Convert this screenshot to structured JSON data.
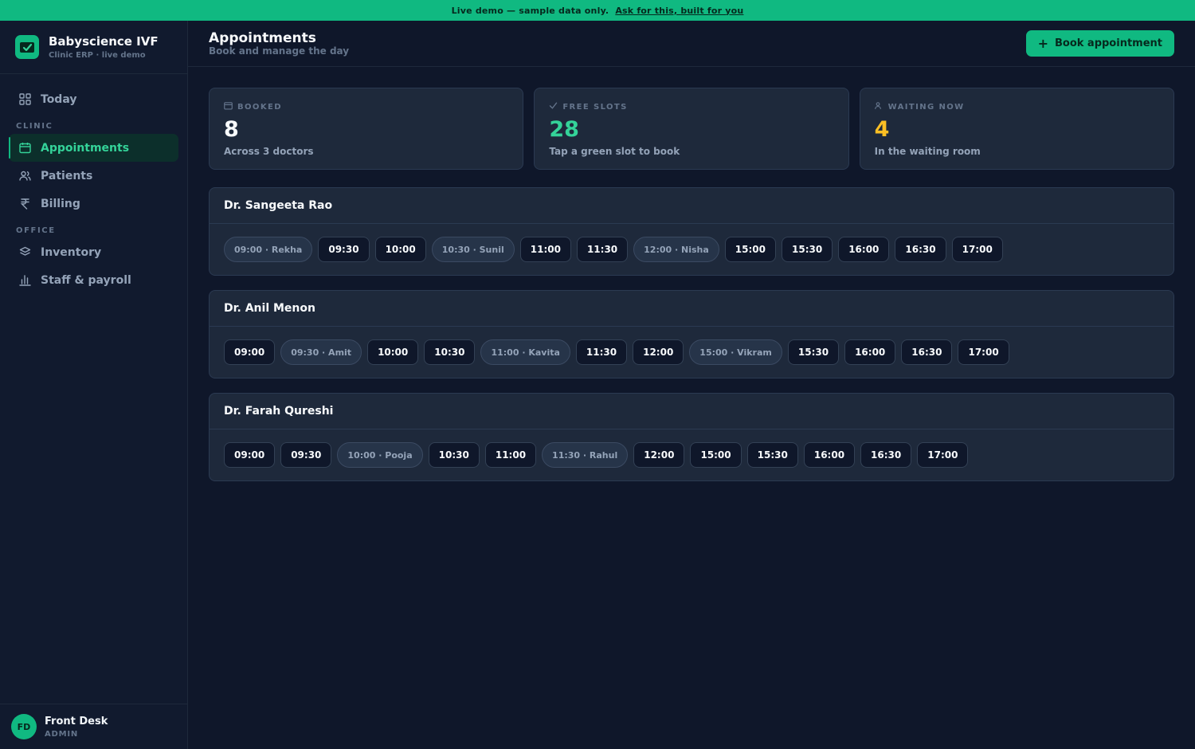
{
  "banner": {
    "text": "Live demo — sample data only.",
    "link": "Ask for this, built for you"
  },
  "brand": {
    "name": "Babyscience IVF",
    "subtitle": "Clinic ERP · live demo"
  },
  "nav": {
    "today": "Today",
    "section_clinic": "CLINIC",
    "appointments": "Appointments",
    "patients": "Patients",
    "billing": "Billing",
    "section_office": "OFFICE",
    "inventory": "Inventory",
    "staff": "Staff & payroll"
  },
  "user": {
    "initials": "FD",
    "name": "Front Desk",
    "role": "ADMIN"
  },
  "header": {
    "title": "Appointments",
    "subtitle": "Book and manage the day",
    "book_button": "Book appointment"
  },
  "stats": [
    {
      "label": "BOOKED",
      "value": "8",
      "note": "Across 3 doctors",
      "color": "#f8fafc"
    },
    {
      "label": "FREE SLOTS",
      "value": "28",
      "note": "Tap a green slot to book",
      "color": "#34d399"
    },
    {
      "label": "WAITING NOW",
      "value": "4",
      "note": "In the waiting room",
      "color": "#fbbf24"
    }
  ],
  "doctors": [
    {
      "name": "Dr. Sangeeta Rao",
      "slots": [
        {
          "label": "09:00 · Rekha",
          "booked": true
        },
        {
          "label": "09:30",
          "booked": false
        },
        {
          "label": "10:00",
          "booked": false
        },
        {
          "label": "10:30 · Sunil",
          "booked": true
        },
        {
          "label": "11:00",
          "booked": false
        },
        {
          "label": "11:30",
          "booked": false
        },
        {
          "label": "12:00 · Nisha",
          "booked": true
        },
        {
          "label": "15:00",
          "booked": false
        },
        {
          "label": "15:30",
          "booked": false
        },
        {
          "label": "16:00",
          "booked": false
        },
        {
          "label": "16:30",
          "booked": false
        },
        {
          "label": "17:00",
          "booked": false
        }
      ]
    },
    {
      "name": "Dr. Anil Menon",
      "slots": [
        {
          "label": "09:00",
          "booked": false
        },
        {
          "label": "09:30 · Amit",
          "booked": true
        },
        {
          "label": "10:00",
          "booked": false
        },
        {
          "label": "10:30",
          "booked": false
        },
        {
          "label": "11:00 · Kavita",
          "booked": true
        },
        {
          "label": "11:30",
          "booked": false
        },
        {
          "label": "12:00",
          "booked": false
        },
        {
          "label": "15:00 · Vikram",
          "booked": true
        },
        {
          "label": "15:30",
          "booked": false
        },
        {
          "label": "16:00",
          "booked": false
        },
        {
          "label": "16:30",
          "booked": false
        },
        {
          "label": "17:00",
          "booked": false
        }
      ]
    },
    {
      "name": "Dr. Farah Qureshi",
      "slots": [
        {
          "label": "09:00",
          "booked": false
        },
        {
          "label": "09:30",
          "booked": false
        },
        {
          "label": "10:00 · Pooja",
          "booked": true
        },
        {
          "label": "10:30",
          "booked": false
        },
        {
          "label": "11:00",
          "booked": false
        },
        {
          "label": "11:30 · Rahul",
          "booked": true
        },
        {
          "label": "12:00",
          "booked": false
        },
        {
          "label": "15:00",
          "booked": false
        },
        {
          "label": "15:30",
          "booked": false
        },
        {
          "label": "16:00",
          "booked": false
        },
        {
          "label": "16:30",
          "booked": false
        },
        {
          "label": "17:00",
          "booked": false
        }
      ]
    }
  ]
}
